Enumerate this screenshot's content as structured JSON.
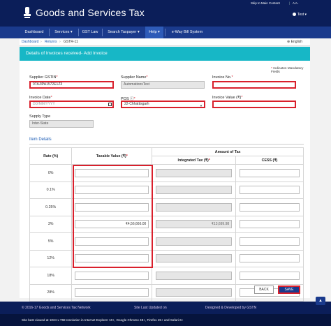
{
  "header": {
    "title": "Goods and Services Tax",
    "skip_link": "Skip to Main Content",
    "a_buttons": "A  A-",
    "user": "Test ▾"
  },
  "nav": [
    "Dashboard",
    "Services ▾",
    "GST Law",
    "Search Taxpayer ▾",
    "Help ▾",
    "e-Way Bill System"
  ],
  "breadcrumb": {
    "items": [
      "Dashboard",
      "Returns",
      "GSTR-11"
    ],
    "language": "English"
  },
  "form": {
    "heading": "Details of Invoices received- Add Invoice",
    "mandatory_note": "Indicates Mandatory Fields",
    "supplier_gstin": {
      "label": "Supplier GSTIN",
      "value": "07AJIPA1572E1Z3"
    },
    "supplier_name": {
      "label": "Supplier Name",
      "value": "AutomationsTest"
    },
    "invoice_no": {
      "label": "Invoice No.",
      "value": ""
    },
    "invoice_date": {
      "label": "Invoice Date",
      "placeholder": "DD/MM/YYYY"
    },
    "pos": {
      "label": "POS",
      "value": "22-Chhattisgarh"
    },
    "invoice_value": {
      "label": "Invoice Value (₹)",
      "value": ""
    },
    "supply_type": {
      "label": "Supply Type",
      "value": "Inter-State"
    }
  },
  "items": {
    "section_title": "Item Details",
    "headers": {
      "rate": "Rate (%)",
      "taxable": "Taxable Value (₹)",
      "amount": "Amount of Tax",
      "igst": "Integrated Tax (₹)",
      "cess": "CESS (₹)"
    },
    "rows": [
      {
        "rate": "0%",
        "taxable": "",
        "igst": "",
        "cess": ""
      },
      {
        "rate": "0.1%",
        "taxable": "",
        "igst": "",
        "cess": ""
      },
      {
        "rate": "0.25%",
        "taxable": "",
        "igst": "",
        "cess": ""
      },
      {
        "rate": "3%",
        "taxable": "₹4,56,666.00",
        "igst": "₹13,699.98",
        "cess": ""
      },
      {
        "rate": "5%",
        "taxable": "",
        "igst": "",
        "cess": ""
      },
      {
        "rate": "12%",
        "taxable": "",
        "igst": "",
        "cess": ""
      },
      {
        "rate": "18%",
        "taxable": "",
        "igst": "",
        "cess": ""
      },
      {
        "rate": "28%",
        "taxable": "",
        "igst": "",
        "cess": ""
      }
    ]
  },
  "buttons": {
    "back": "BACK",
    "save": "SAVE"
  },
  "footer": {
    "copyright": "© 2016-17 Goods and Services Tax Network",
    "updated": "Site Last Updated on",
    "designed": "Designed & Developed by GSTN",
    "browser_note": "Site best viewed at 1024 x 768 resolution in Internet Explorer 10+, Google Chrome 49+, Firefox 45+ and Safari 6+"
  },
  "colors": {
    "header": "#0b1e59",
    "nav": "#1a3a8c",
    "accent": "#17b7c6",
    "highlight": "#d9202c"
  }
}
